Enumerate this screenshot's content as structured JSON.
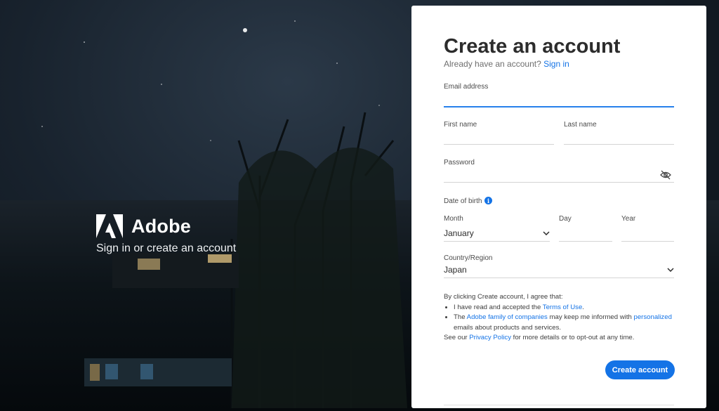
{
  "brand": {
    "name": "Adobe",
    "tagline": "Sign in or create an account"
  },
  "form": {
    "title": "Create an account",
    "signin_prompt": "Already have an account?",
    "signin_link": "Sign in",
    "email_label": "Email address",
    "email_value": "",
    "first_name_label": "First name",
    "last_name_label": "Last name",
    "password_label": "Password",
    "dob_label": "Date of birth",
    "month_label": "Month",
    "month_value": "January",
    "day_label": "Day",
    "year_label": "Year",
    "country_label": "Country/Region",
    "country_value": "Japan",
    "terms": {
      "intro": "By clicking Create account, I agree that:",
      "item1_pre": "I have read and accepted the ",
      "item1_link": "Terms of Use",
      "item1_post": ".",
      "item2_pre": "The ",
      "item2_link1": "Adobe family of companies",
      "item2_mid": " may keep me informed with ",
      "item2_link2": "personalized",
      "item2_post": " emails about products and services.",
      "outro_pre": "See our ",
      "outro_link": "Privacy Policy",
      "outro_post": " for more details or to opt-out at any time."
    },
    "submit_label": "Create account"
  },
  "icons": {
    "password_toggle": "eye-slash-icon",
    "dob_info": "info-icon",
    "dropdown": "chevron-down-icon"
  },
  "colors": {
    "accent": "#1473e6",
    "title": "#2c2c2c"
  }
}
